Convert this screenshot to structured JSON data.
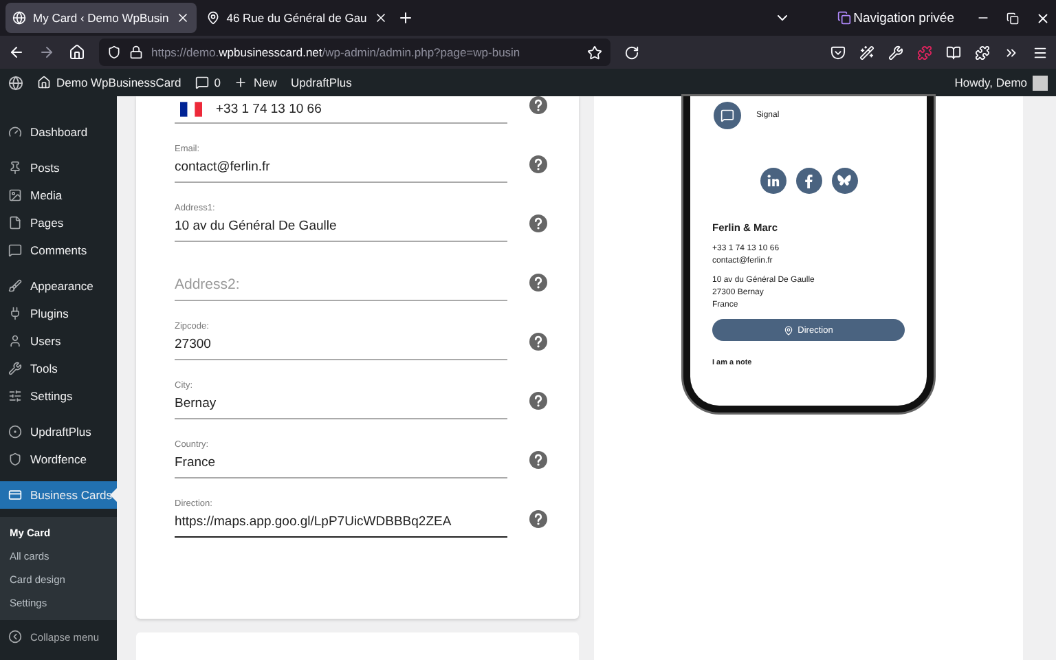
{
  "browser": {
    "tabs": [
      {
        "title": "My Card ‹ Demo WpBusin",
        "selected": true
      },
      {
        "title": "46 Rue du Général de Gau",
        "selected": false
      }
    ],
    "private_label": "Navigation privée",
    "url_base": "https://demo.",
    "url_domain": "wpbusinesscard.net",
    "url_path": "/wp-admin/admin.php?page=wp-busin"
  },
  "admin_bar": {
    "site": "Demo WpBusinessCard",
    "comments": "0",
    "new": "New",
    "plugin": "UpdraftPlus",
    "greeting": "Howdy, Demo"
  },
  "sidebar": {
    "sections": [
      {
        "items": [
          {
            "label": "Dashboard",
            "selected": false
          }
        ]
      },
      {
        "items": [
          {
            "label": "Posts",
            "selected": false
          },
          {
            "label": "Media",
            "selected": false
          },
          {
            "label": "Pages",
            "selected": false
          },
          {
            "label": "Comments",
            "selected": false
          }
        ]
      },
      {
        "items": [
          {
            "label": "Appearance",
            "selected": false
          },
          {
            "label": "Plugins",
            "selected": false
          },
          {
            "label": "Users",
            "selected": false
          },
          {
            "label": "Tools",
            "selected": false
          },
          {
            "label": "Settings",
            "selected": false
          }
        ]
      },
      {
        "items": [
          {
            "label": "UpdraftPlus",
            "selected": false
          },
          {
            "label": "Wordfence",
            "selected": false
          }
        ]
      },
      {
        "items": [
          {
            "label": "Business Cards",
            "selected": true
          }
        ]
      }
    ],
    "submenu": [
      {
        "label": "My Card",
        "selected": true
      },
      {
        "label": "All cards",
        "selected": false
      },
      {
        "label": "Card design",
        "selected": false
      },
      {
        "label": "Settings",
        "selected": false
      }
    ],
    "collapse": "Collapse menu"
  },
  "form": {
    "phone": "+33 1 74 13 10 66",
    "fields": [
      {
        "label": "Email:",
        "value": "contact@ferlin.fr",
        "focused": false
      },
      {
        "label": "Address1:",
        "value": "10 av du Général De Gaulle",
        "focused": false
      },
      {
        "placeholder": "Address2:",
        "focused": false
      },
      {
        "label": "Zipcode:",
        "value": "27300",
        "focused": false
      },
      {
        "label": "City:",
        "value": "Bernay",
        "focused": false
      },
      {
        "label": "Country:",
        "value": "France",
        "focused": false
      },
      {
        "label": "Direction:",
        "value": "https://maps.app.goo.gl/LpP7UicWDBBBq2ZEA",
        "focused": true
      }
    ]
  },
  "preview": {
    "signal": "Signal",
    "name": "Ferlin & Marc",
    "contact_lines": [
      "+33 1 74 13 10 66",
      "contact@ferlin.fr"
    ],
    "address_lines": [
      "10 av du Général De Gaulle",
      "27300 Bernay",
      "France"
    ],
    "button": "Direction",
    "note": "I am a note"
  }
}
